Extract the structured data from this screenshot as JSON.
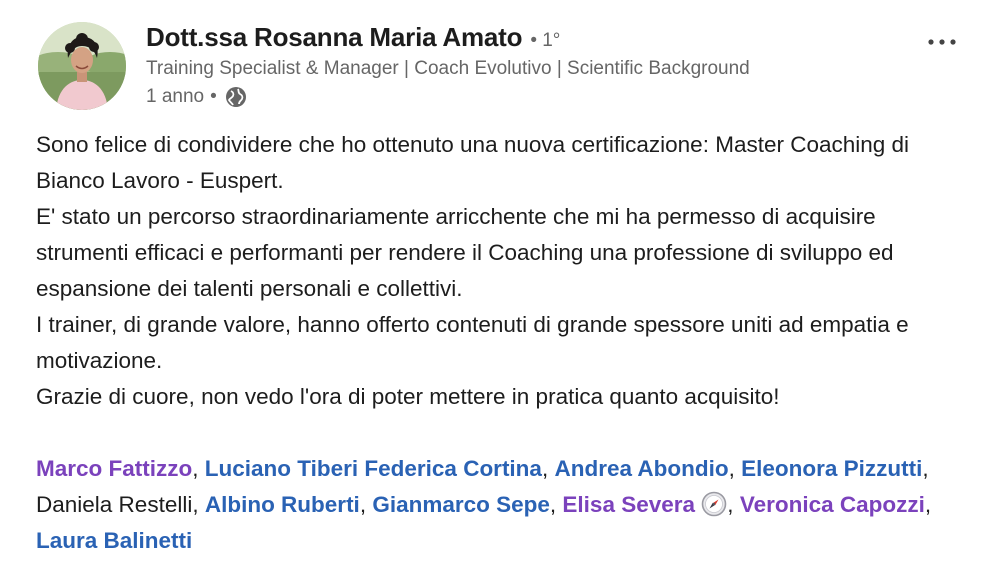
{
  "post": {
    "author": {
      "name": "Dott.ssa Rosanna Maria Amato",
      "degree": "• 1°",
      "headline": "Training Specialist & Manager | Coach Evolutivo | Scientific Background",
      "time": "1 anno",
      "time_separator": "•",
      "visibility_icon": "globe-icon"
    },
    "more_icon": "more-horizontal-icon",
    "body_lines": [
      "Sono felice di condividere che ho ottenuto una nuova certificazione: Master Coaching di Bianco Lavoro - Euspert.",
      "E' stato un percorso straordinariamente arricchente che mi ha permesso di acquisire strumenti efficaci e performanti per rendere il Coaching una professione di sviluppo ed espansione dei talenti personali e collettivi.",
      "I trainer, di grande valore, hanno offerto contenuti di grande spessore uniti ad empatia e motivazione.",
      "Grazie di cuore, non vedo l'ora di poter mettere in pratica quanto acquisito!"
    ],
    "tags": {
      "t1": "Marco Fattizzo",
      "s1": ", ",
      "t2": "Luciano Tiberi Federica Cortina",
      "s2": ", ",
      "t3": "Andrea Abondio",
      "s3": ", ",
      "t4": "Eleonora Pizzutti",
      "s4": ", Daniela Restelli, ",
      "t5": "Albino Ruberti",
      "s5": ", ",
      "t6": "Gianmarco Sepe",
      "s6": ", ",
      "t7": "Elisa Severa",
      "compass_icon": "compass-icon",
      "s7": ", ",
      "t8": "Veronica Capozzi",
      "s8": ", ",
      "t9": "Laura Balinetti"
    },
    "colors": {
      "mention_purple": "#7b42bc",
      "mention_blue": "#2a62b4",
      "text": "#1d1d1d",
      "secondary": "#666666"
    }
  }
}
